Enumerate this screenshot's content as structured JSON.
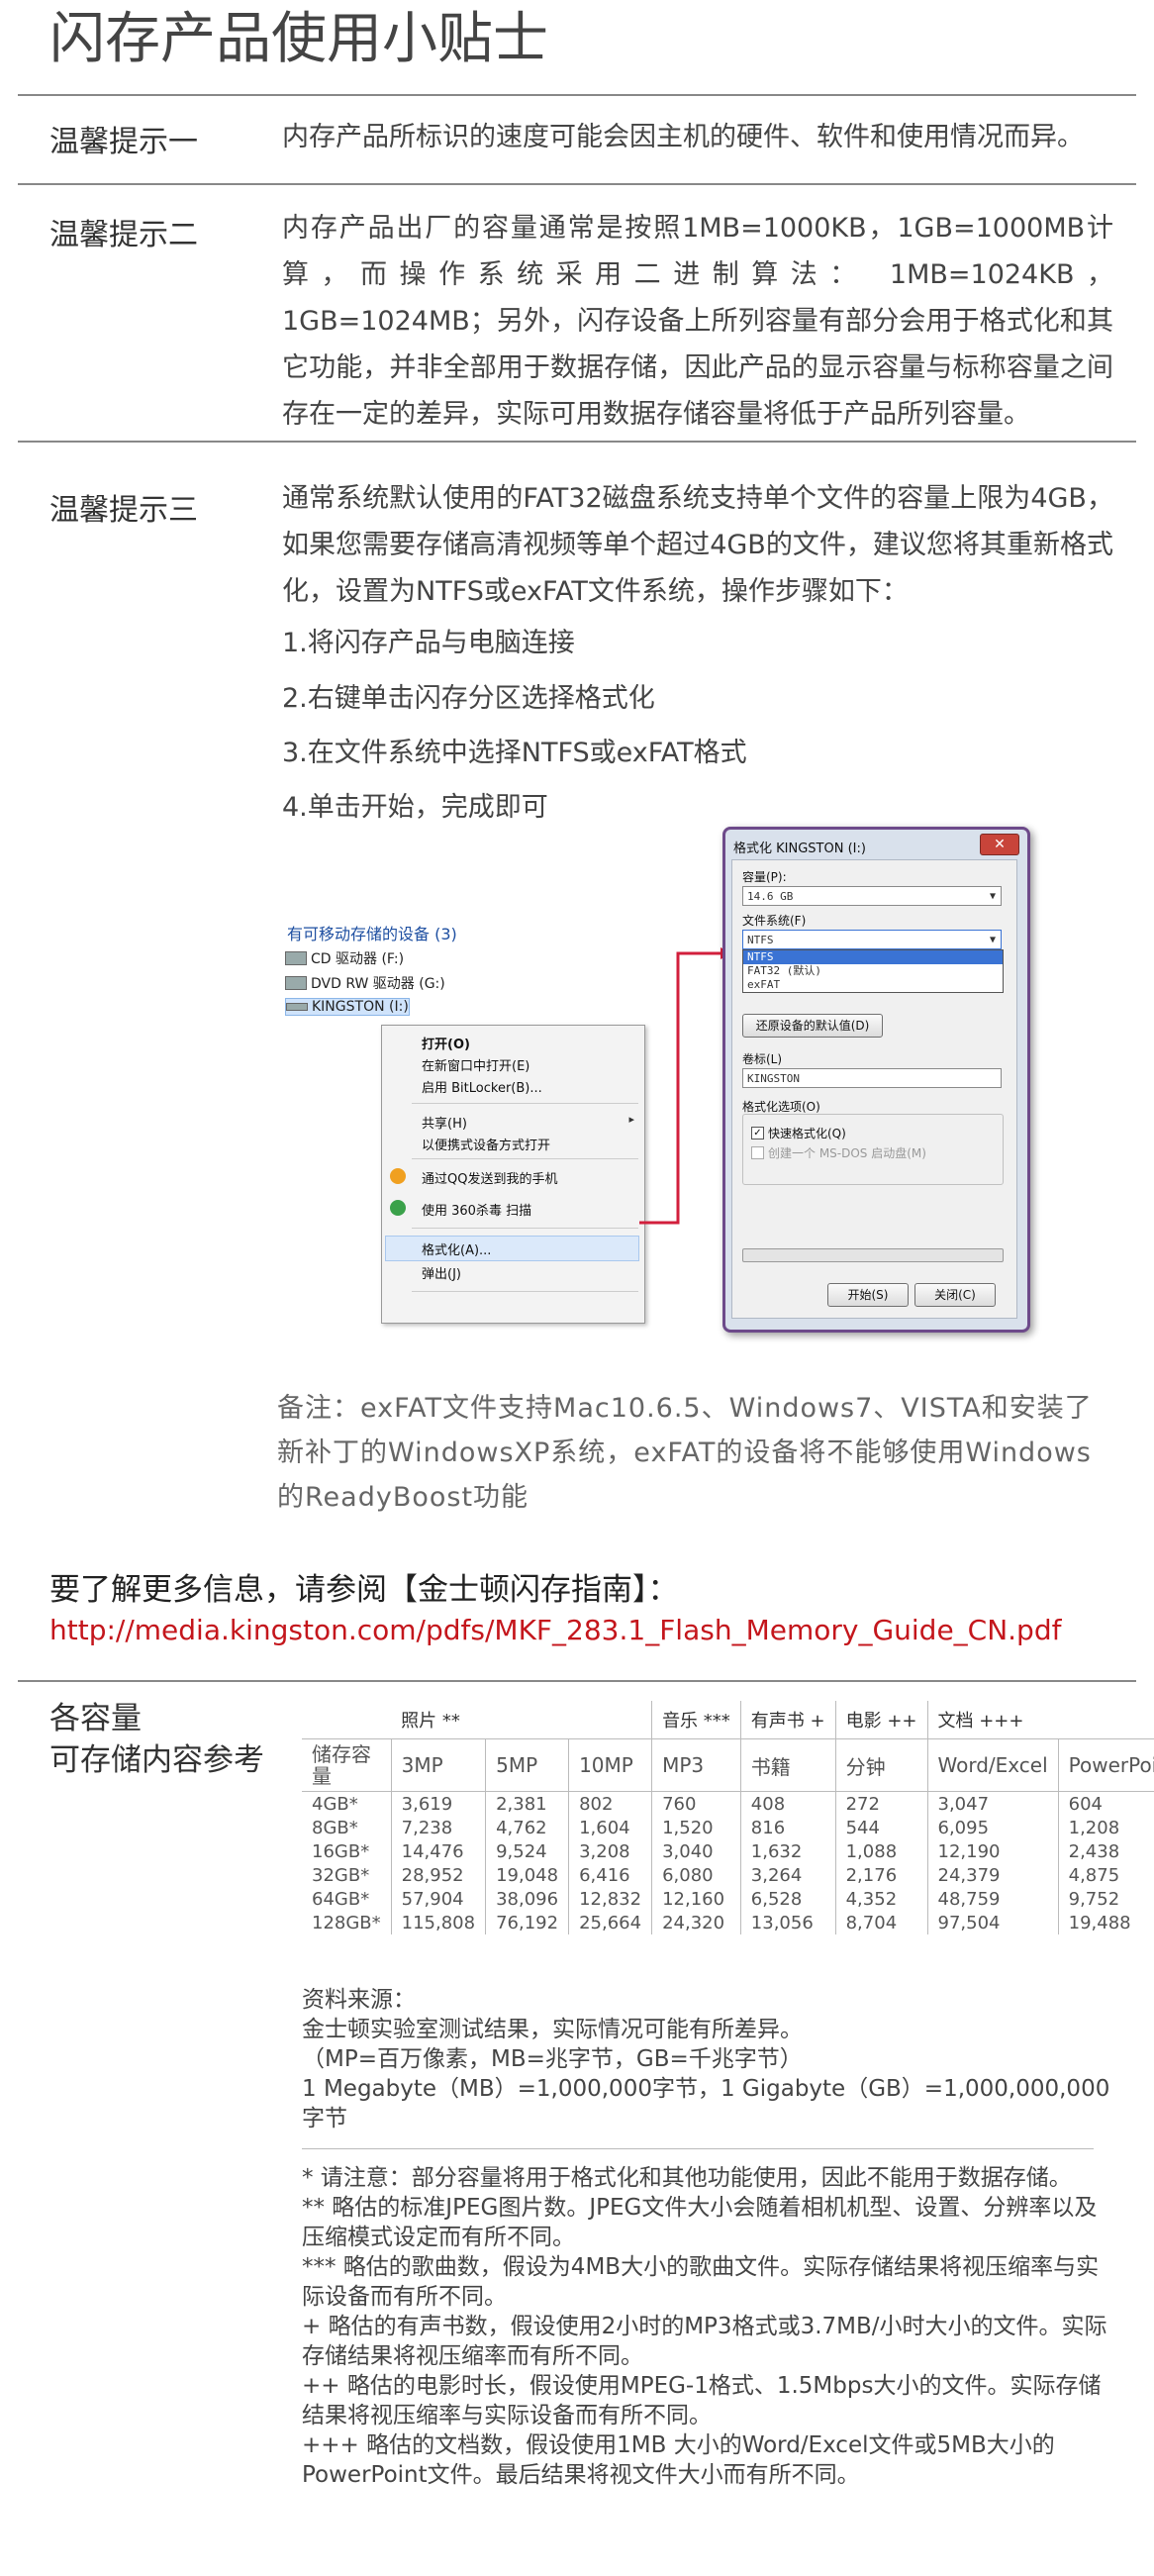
{
  "title": "闪存产品使用小贴士",
  "tips": [
    {
      "label": "温馨提示一",
      "text": "内存产品所标识的速度可能会因主机的硬件、软件和使用情况而异。"
    },
    {
      "label": "温馨提示二",
      "text": "内存产品出厂的容量通常是按照1MB=1000KB，1GB=1000MB计算，而操作系统采用二进制算法： 1MB=1024KB，1GB=1024MB；另外，闪存设备上所列容量有部分会用于格式化和其它功能，并非全部用于数据存储，因此产品的显示容量与标称容量之间存在一定的差异，实际可用数据存储容量将低于产品所列容量。"
    },
    {
      "label": "温馨提示三",
      "text": "通常系统默认使用的FAT32磁盘系统支持单个文件的容量上限为4GB，如果您需要存储高清视频等单个超过4GB的文件，建议您将其重新格式化，设置为NTFS或exFAT文件系统，操作步骤如下："
    }
  ],
  "steps": [
    "1.将闪存产品与电脑连接",
    "2.右键单击闪存分区选择格式化",
    "3.在文件系统中选择NTFS或exFAT格式",
    "4.单击开始，完成即可"
  ],
  "explorer": {
    "section_title": "有可移动存储的设备 (3)",
    "drives": [
      "CD 驱动器 (F:)",
      "DVD RW 驱动器 (G:)",
      "KINGSTON (I:)"
    ]
  },
  "context_menu": {
    "items": [
      "打开(O)",
      "在新窗口中打开(E)",
      "启用 BitLocker(B)...",
      "共享(H)",
      "以便携式设备方式打开",
      "通过QQ发送到我的手机",
      "使用 360杀毒 扫描",
      "格式化(A)...",
      "弹出(J)"
    ]
  },
  "format_dialog": {
    "title": "格式化 KINGSTON (I:)",
    "close": "✕",
    "capacity_label": "容量(P):",
    "capacity_value": "14.6 GB",
    "fs_label": "文件系统(F)",
    "fs_value": "NTFS",
    "fs_options": [
      "NTFS",
      "FAT32 (默认)",
      "exFAT"
    ],
    "restore_button": "还原设备的默认值(D)",
    "volume_label": "卷标(L)",
    "volume_value": "KINGSTON",
    "options_label": "格式化选项(O)",
    "quick_format": "快速格式化(Q)",
    "msdos": "创建一个 MS-DOS 启动盘(M)",
    "start_button": "开始(S)",
    "close_button": "关闭(C)"
  },
  "note": "备注：exFAT文件支持Mac10.6.5、Windows7、VISTA和安装了新补丁的WindowsXP系统，exFAT的设备将不能够使用Windows的ReadyBoost功能",
  "more_info": "要了解更多信息，请参阅【金士顿闪存指南】：",
  "link": "http://media.kingston.com/pdfs/MKF_283.1_Flash_Memory_Guide_CN.pdf",
  "capacity_title": [
    "各容量",
    "可存储内容参考"
  ],
  "table": {
    "groups": [
      "照片 **",
      "音乐 ***",
      "有声书 +",
      "电影 ++",
      "文档 +++"
    ],
    "headers": [
      "储存容量",
      "3MP",
      "5MP",
      "10MP",
      "MP3",
      "书籍",
      "分钟",
      "Word/Excel",
      "PowerPoint"
    ],
    "rows": [
      [
        "4GB*",
        "3,619",
        "2,381",
        "802",
        "760",
        "408",
        "272",
        "3,047",
        "604"
      ],
      [
        "8GB*",
        "7,238",
        "4,762",
        "1,604",
        "1,520",
        "816",
        "544",
        "6,095",
        "1,208"
      ],
      [
        "16GB*",
        "14,476",
        "9,524",
        "3,208",
        "3,040",
        "1,632",
        "1,088",
        "12,190",
        "2,438"
      ],
      [
        "32GB*",
        "28,952",
        "19,048",
        "6,416",
        "6,080",
        "3,264",
        "2,176",
        "24,379",
        "4,875"
      ],
      [
        "64GB*",
        "57,904",
        "38,096",
        "12,832",
        "12,160",
        "6,528",
        "4,352",
        "48,759",
        "9,752"
      ],
      [
        "128GB*",
        "115,808",
        "76,192",
        "25,664",
        "24,320",
        "13,056",
        "8,704",
        "97,504",
        "19,488"
      ]
    ]
  },
  "source": {
    "title": "资料来源：",
    "lines": [
      "金士顿实验室测试结果，实际情况可能有所差异。",
      "（MP=百万像素，MB=兆字节，GB=千兆字节）",
      "1 Megabyte（MB）=1,000,000字节，1 Gigabyte（GB）=1,000,000,000字节"
    ]
  },
  "footnotes": [
    "* 请注意：部分容量将用于格式化和其他功能使用，因此不能用于数据存储。",
    "** 略估的标准JPEG图片数。JPEG文件大小会随着相机机型、设置、分辨率以及压缩模式设定而有所不同。",
    "*** 略估的歌曲数，假设为4MB大小的歌曲文件。实际存储结果将视压缩率与实际设备而有所不同。",
    "+ 略估的有声书数，假设使用2小时的MP3格式或3.7MB/小时大小的文件。实际存储结果将视压缩率而有所不同。",
    "++ 略估的电影时长，假设使用MPEG-1格式、1.5Mbps大小的文件。实际存储结果将视压缩率与实际设备而有所不同。",
    "+++ 略估的文档数，假设使用1MB 大小的Word/Excel文件或5MB大小的PowerPoint文件。最后结果将视文件大小而有所不同。"
  ]
}
